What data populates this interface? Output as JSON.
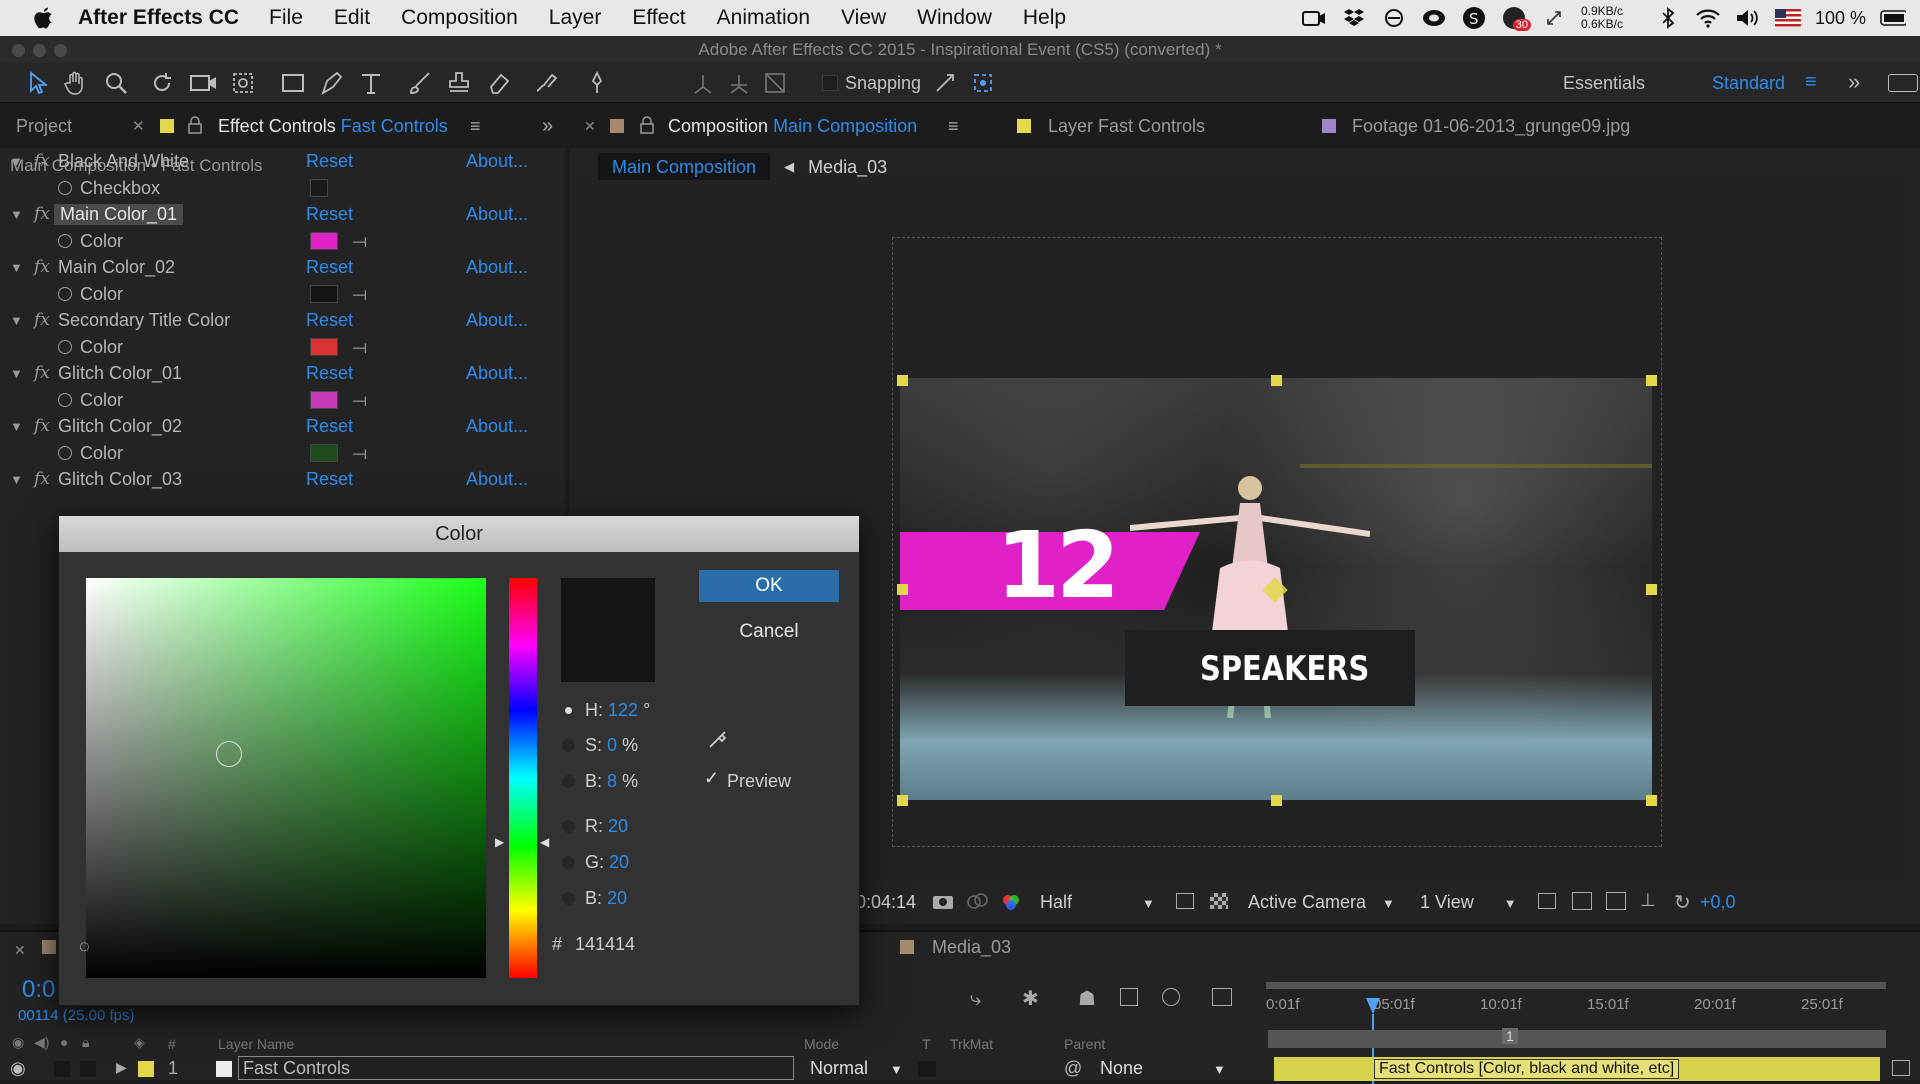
{
  "menubar": {
    "app_name": "After Effects CC",
    "items": [
      "File",
      "Edit",
      "Composition",
      "Layer",
      "Effect",
      "Animation",
      "View",
      "Window",
      "Help"
    ],
    "badge": "30",
    "net_up": "0.9KB/c",
    "net_down": "0.6KB/c",
    "battery": "100 %"
  },
  "window_title": "Adobe After Effects CC 2015 - Inspirational Event (CS5) (converted) *",
  "toolbar": {
    "snapping_label": "Snapping",
    "workspace_1": "Essentials",
    "workspace_2": "Standard"
  },
  "left_panel": {
    "tab_project": "Project",
    "tab_effect_controls": "Effect Controls",
    "tab_effect_target": "Fast Controls",
    "breadcrumb": "Main Composition • Fast Controls",
    "reset_label": "Reset",
    "about_label": "About...",
    "effects": [
      {
        "name": "Black And White",
        "param": "Checkbox",
        "color": "#1b1b1b"
      },
      {
        "name": "Main Color_01",
        "param": "Color",
        "color": "#e021c8"
      },
      {
        "name": "Main Color_02",
        "param": "Color",
        "color": "#141414"
      },
      {
        "name": "Secondary Title Color",
        "param": "Color",
        "color": "#d93232"
      },
      {
        "name": "Glitch Color_01",
        "param": "Color",
        "color": "#c53ab8"
      },
      {
        "name": "Glitch Color_02",
        "param": "Color",
        "color": "#1e4a1e"
      },
      {
        "name": "Glitch Color_03",
        "param": "",
        "color": ""
      }
    ]
  },
  "comp_panel": {
    "tab_composition": "Composition",
    "tab_comp_name": "Main Composition",
    "tab_layer": "Layer Fast Controls",
    "tab_footage": "Footage 01-06-2013_grunge09.jpg",
    "nav_active": "Main Composition",
    "nav_next": "Media_03",
    "overlay_number": "12",
    "overlay_title": "SPEAKERS"
  },
  "viewer_bar": {
    "timecode": "0:04:14",
    "resolution": "Half",
    "camera": "Active Camera",
    "views": "1 View",
    "exposure": "+0,0"
  },
  "timeline": {
    "tab": "Media_03",
    "current_time": "0:0",
    "frame_info": "00114 (25.00 fps)",
    "col_hash": "#",
    "col_layer_name": "Layer Name",
    "col_mode": "Mode",
    "col_t": "T",
    "col_trkmat": "TrkMat",
    "col_parent": "Parent",
    "ruler": [
      "0:01f",
      "05:01f",
      "10:01f",
      "15:01f",
      "20:01f",
      "25:01f"
    ],
    "marker": "1",
    "layer": {
      "index": "1",
      "name": "Fast Controls",
      "mode": "Normal",
      "parent": "None",
      "bar_label": "Fast Controls [Color, black and white, etc]"
    }
  },
  "color_dialog": {
    "title": "Color",
    "ok_label": "OK",
    "cancel_label": "Cancel",
    "preview_label": "Preview",
    "preview_checked": true,
    "h_label": "H:",
    "h_value": "122",
    "h_unit": "°",
    "s_label": "S:",
    "s_value": "0",
    "s_unit": "%",
    "b_label": "B:",
    "b_value": "8",
    "b_unit": "%",
    "r_label": "R:",
    "r_value": "20",
    "g_label": "G:",
    "g_value": "20",
    "bl_label": "B:",
    "bl_value": "20",
    "hex_label": "#",
    "hex_value": "141414",
    "current_color": "#141414"
  },
  "colors": {
    "accent": "#2d8ceb",
    "handle": "#e2d84a",
    "magenta": "#e021c8",
    "layer_bar": "#d6d04a"
  }
}
